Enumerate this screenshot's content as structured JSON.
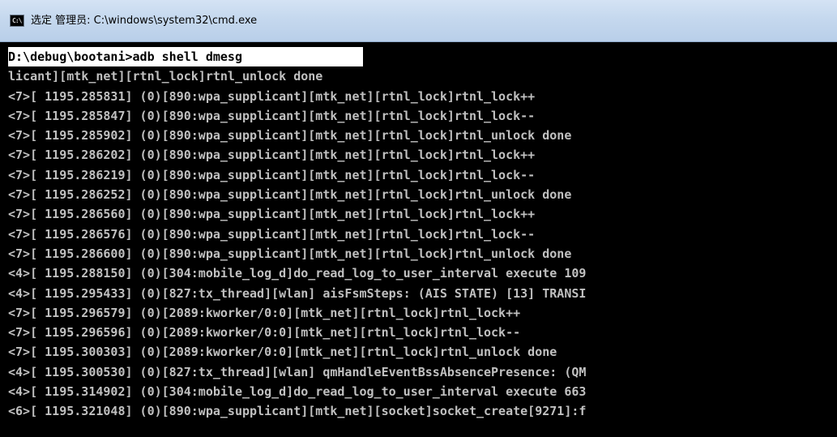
{
  "window": {
    "title": "选定 管理员: C:\\windows\\system32\\cmd.exe",
    "icon": "cmd-console-icon",
    "icon_glyph": "C:\\"
  },
  "colors": {
    "console_background": "#000000",
    "console_text": "#c0c0c0",
    "selection_background": "#ffffff",
    "selection_text": "#000000",
    "titlebar": "#c5d8ee"
  },
  "console": {
    "lines": [
      "D:\\debug\\bootani>adb shell dmesg",
      "licant][mtk_net][rtnl_lock]rtnl_unlock done",
      "<7>[ 1195.285831] (0)[890:wpa_supplicant][mtk_net][rtnl_lock]rtnl_lock++",
      "<7>[ 1195.285847] (0)[890:wpa_supplicant][mtk_net][rtnl_lock]rtnl_lock--",
      "<7>[ 1195.285902] (0)[890:wpa_supplicant][mtk_net][rtnl_lock]rtnl_unlock done",
      "<7>[ 1195.286202] (0)[890:wpa_supplicant][mtk_net][rtnl_lock]rtnl_lock++",
      "<7>[ 1195.286219] (0)[890:wpa_supplicant][mtk_net][rtnl_lock]rtnl_lock--",
      "<7>[ 1195.286252] (0)[890:wpa_supplicant][mtk_net][rtnl_lock]rtnl_unlock done",
      "<7>[ 1195.286560] (0)[890:wpa_supplicant][mtk_net][rtnl_lock]rtnl_lock++",
      "<7>[ 1195.286576] (0)[890:wpa_supplicant][mtk_net][rtnl_lock]rtnl_lock--",
      "<7>[ 1195.286600] (0)[890:wpa_supplicant][mtk_net][rtnl_lock]rtnl_unlock done",
      "<4>[ 1195.288150] (0)[304:mobile_log_d]do_read_log_to_user_interval execute 109",
      "<4>[ 1195.295433] (0)[827:tx_thread][wlan] aisFsmSteps: (AIS STATE) [13] TRANSI",
      "<7>[ 1195.296579] (0)[2089:kworker/0:0][mtk_net][rtnl_lock]rtnl_lock++",
      "<7>[ 1195.296596] (0)[2089:kworker/0:0][mtk_net][rtnl_lock]rtnl_lock--",
      "<7>[ 1195.300303] (0)[2089:kworker/0:0][mtk_net][rtnl_lock]rtnl_unlock done",
      "<4>[ 1195.300530] (0)[827:tx_thread][wlan] qmHandleEventBssAbsencePresence: (QM",
      "<4>[ 1195.314902] (0)[304:mobile_log_d]do_read_log_to_user_interval execute 663",
      "<6>[ 1195.321048] (0)[890:wpa_supplicant][mtk_net][socket]socket_create[9271]:f"
    ]
  }
}
